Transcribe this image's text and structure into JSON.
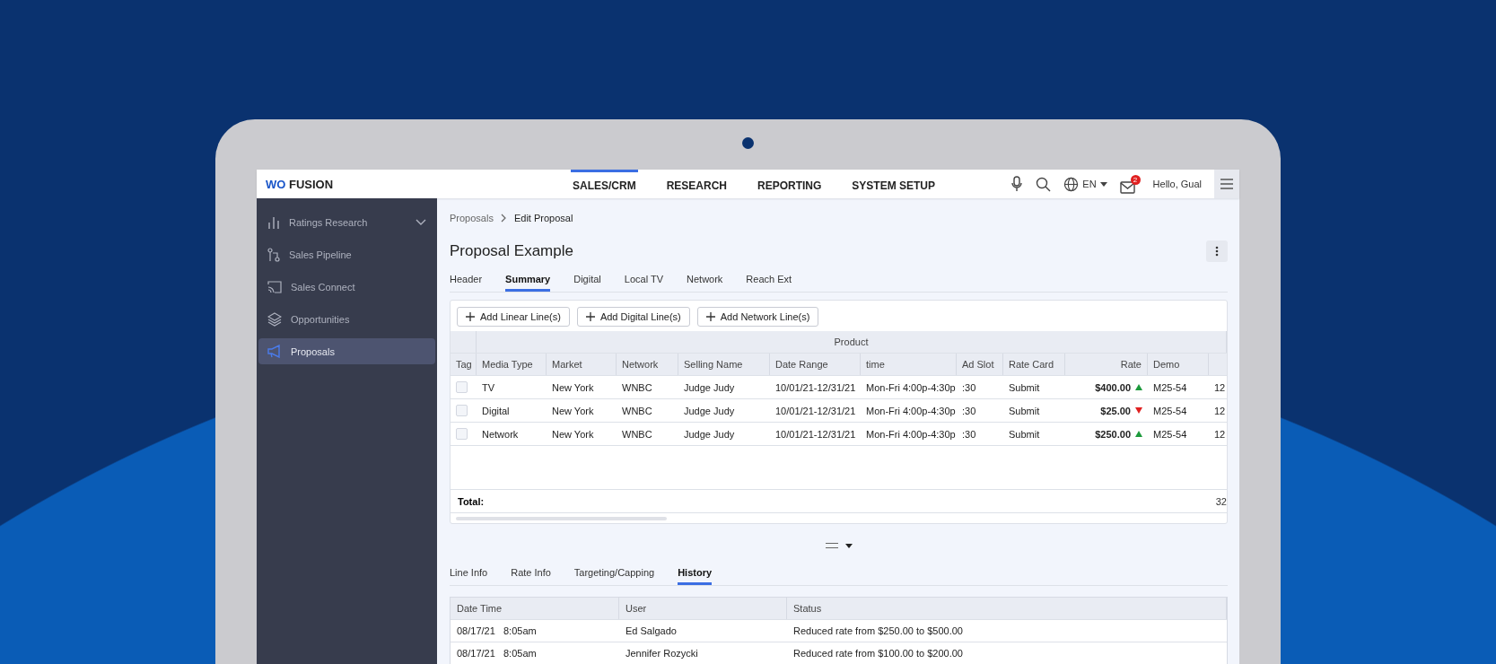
{
  "app": {
    "logo_prefix": "WO",
    "logo_name": "FUSION",
    "greeting": "Hello, Gual",
    "language": "EN",
    "notifications": "2"
  },
  "nav": [
    {
      "label": "SALES/CRM",
      "selected": true
    },
    {
      "label": "RESEARCH",
      "selected": false
    },
    {
      "label": "REPORTING",
      "selected": false
    },
    {
      "label": "SYSTEM SETUP",
      "selected": false
    }
  ],
  "sidebar": {
    "items": [
      {
        "label": "Ratings Research",
        "expandable": true,
        "selected": false
      },
      {
        "label": "Sales Pipeline",
        "expandable": false,
        "selected": false
      },
      {
        "label": "Sales Connect",
        "expandable": false,
        "selected": false
      },
      {
        "label": "Opportunities",
        "expandable": false,
        "selected": false
      },
      {
        "label": "Proposals",
        "expandable": false,
        "selected": true
      }
    ]
  },
  "breadcrumb": [
    "Proposals",
    "Edit Proposal"
  ],
  "title": "Proposal Example",
  "tabs": [
    {
      "label": "Header",
      "selected": false
    },
    {
      "label": "Summary",
      "selected": true
    },
    {
      "label": "Digital",
      "selected": false
    },
    {
      "label": "Local TV",
      "selected": false
    },
    {
      "label": "Network",
      "selected": false
    },
    {
      "label": "Reach Ext",
      "selected": false
    }
  ],
  "actions": [
    "Add Linear Line(s)",
    "Add Digital Line(s)",
    "Add Network Line(s)"
  ],
  "table": {
    "group_header": "Product",
    "columns": [
      "Tag",
      "Media Type",
      "Market",
      "Network",
      "Selling Name",
      "Date Range",
      "time",
      "Ad Slot",
      "Rate Card",
      "Rate",
      "Demo",
      ""
    ],
    "rows": [
      {
        "checked": false,
        "cells": [
          "",
          "TV",
          "New York",
          "WNBC",
          "Judge Judy",
          "10/01/21-12/31/21",
          "Mon-Fri 4:00p-4:30p",
          ":30",
          "Submit",
          "$400.00",
          "M25-54",
          "12"
        ],
        "rate_increased": true
      },
      {
        "checked": false,
        "cells": [
          "",
          "Digital",
          "New York",
          "WNBC",
          "Judge Judy",
          "10/01/21-12/31/21",
          "Mon-Fri 4:00p-4:30p",
          ":30",
          "Submit",
          "$25.00",
          "M25-54",
          "12"
        ],
        "rate_increased": false
      },
      {
        "checked": false,
        "cells": [
          "",
          "Network",
          "New York",
          "WNBC",
          "Judge Judy",
          "10/01/21-12/31/21",
          "Mon-Fri 4:00p-4:30p",
          ":30",
          "Submit",
          "$250.00",
          "M25-54",
          "12"
        ],
        "rate_increased": true
      }
    ],
    "total_label": "Total:",
    "total_value": "32"
  },
  "detail_tabs": [
    {
      "label": "Line Info",
      "selected": false
    },
    {
      "label": "Rate Info",
      "selected": false
    },
    {
      "label": "Targeting/Capping",
      "selected": false
    },
    {
      "label": "History",
      "selected": true
    }
  ],
  "history": {
    "columns": [
      "Date Time",
      "User",
      "Status"
    ],
    "rows": [
      {
        "date": "08/17/21",
        "time": "8:05am",
        "user": "Ed Salgado",
        "status": "Reduced rate from $250.00 to $500.00"
      },
      {
        "date": "08/17/21",
        "time": "8:05am",
        "user": "Jennifer Rozycki",
        "status": "Reduced rate from $100.00 to $200.00"
      }
    ]
  }
}
